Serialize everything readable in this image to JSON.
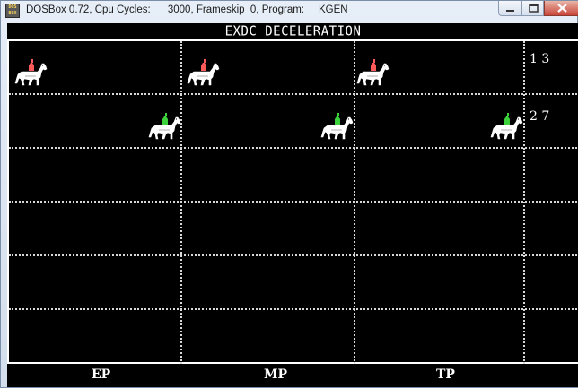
{
  "window": {
    "title": "DOSBox 0.72, Cpu Cycles:      3000, Frameskip  0, Program:     KGEN",
    "icon_top": "DOS",
    "icon_bottom": "BOX"
  },
  "screen": {
    "title": "EXDC DECELERATION",
    "lanes": [
      {
        "number": "1 3",
        "rider_color": "#ff5a5a"
      },
      {
        "number": "2 7",
        "rider_color": "#3cd23c"
      }
    ],
    "points": [
      "EP",
      "MP",
      "TP"
    ]
  },
  "colors": {
    "background": "#000000",
    "foreground": "#ffffff"
  }
}
